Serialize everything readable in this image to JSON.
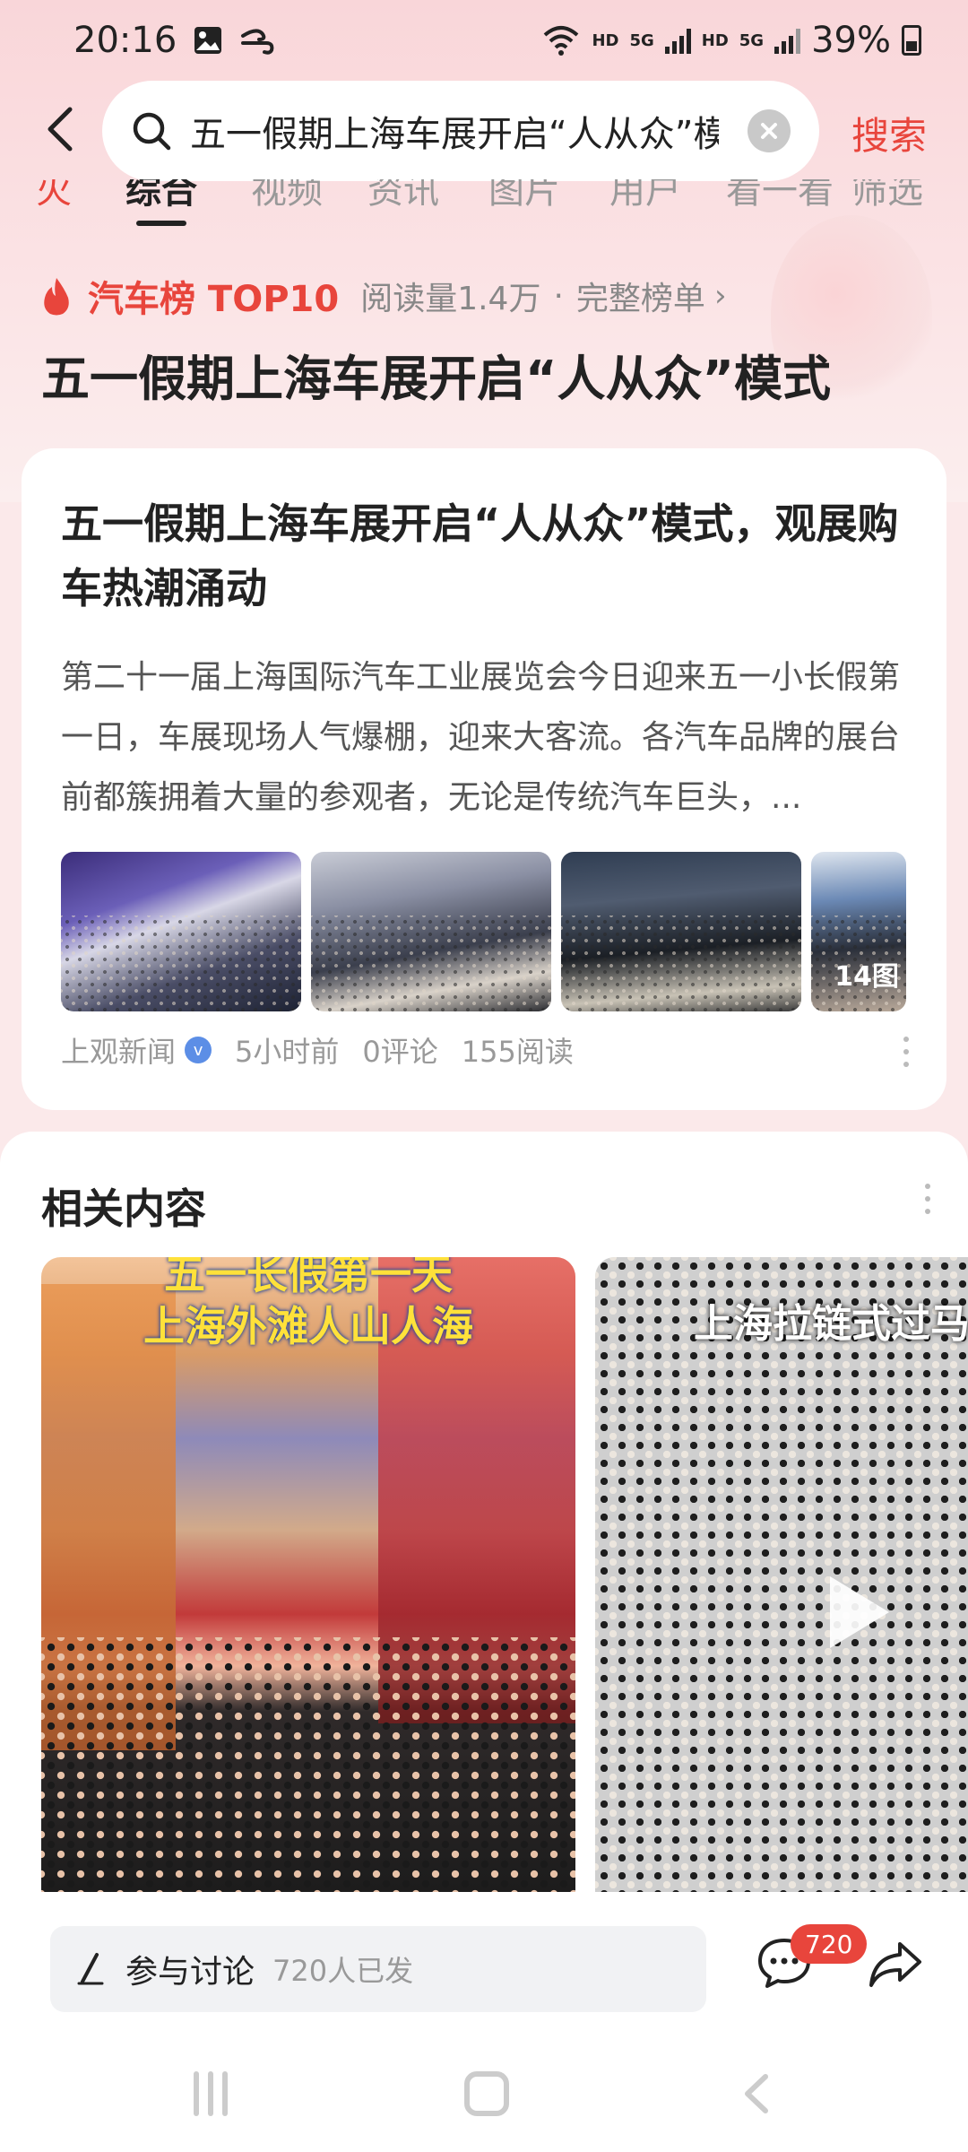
{
  "status_bar": {
    "time": "20:16",
    "battery": "39%",
    "hd1": "HD",
    "hd2": "HD",
    "net1": "5G",
    "net2": "5G",
    "icons": [
      "gallery-icon",
      "wind-icon",
      "wifi-icon",
      "signal-icon",
      "battery-icon"
    ]
  },
  "search": {
    "query": "五一假期上海车展开启“人从众”模",
    "button_label": "搜索"
  },
  "tabs": [
    "综合",
    "视频",
    "资讯",
    "图片",
    "用户",
    "看一看",
    "筛选"
  ],
  "hot_rank": {
    "label": "汽车榜 TOP10",
    "reads": "阅读量1.4万",
    "separator": "·",
    "full_list": "完整榜单",
    "headline": "五一假期上海车展开启“人从众”模式"
  },
  "article": {
    "title": "五一假期上海车展开启“人从众”模式，观展购车热潮涌动",
    "summary": "第二十一届上海国际汽车工业展览会今日迎来五一小长假第一日，车展现场人气爆棚，迎来大客流。各汽车品牌的展台前都簇拥着大量的参观者，无论是传统汽车巨头，...",
    "image_count": "14图",
    "source": "上观新闻",
    "verified": "v",
    "time_ago": "5小时前",
    "comments": "0评论",
    "reads": "155阅读"
  },
  "related": {
    "title": "相关内容",
    "videos": [
      {
        "caption": "五一长假第一天\n上海外滩人山人海"
      },
      {
        "caption": "上海拉链式过马"
      }
    ]
  },
  "bottom_bar": {
    "discuss_label": "参与讨论",
    "discuss_count": "720人已发",
    "comment_badge": "720"
  },
  "colors": {
    "accent": "#e8453c",
    "verified": "#5c8ee6",
    "caption_yellow": "#ffe13a"
  }
}
